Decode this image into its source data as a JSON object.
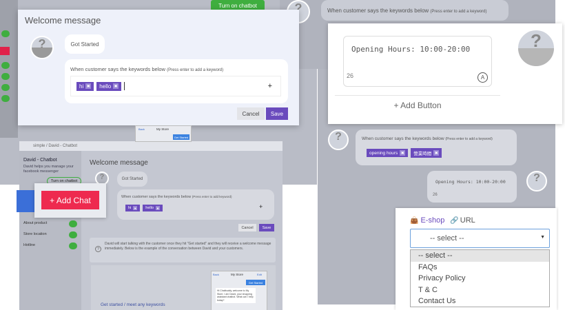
{
  "top": {
    "chatbot_button": "Turn on chatbot"
  },
  "modal": {
    "title": "Welcome message",
    "get_started": "Got Started",
    "keyword_label": "When customer says the keywords below",
    "keyword_hint": "(Press enter to add a keyword)",
    "keywords": [
      "hi",
      "hello"
    ],
    "add_icon": "+",
    "cancel": "Cancel",
    "save": "Save"
  },
  "right_top": {
    "keyword_label": "When customer says the keywords below",
    "keyword_hint": "(Press enter to add a keyword)"
  },
  "right_card": {
    "message": "Opening Hours: 10:00-20:00",
    "char_count": "26",
    "emoji_badge": "A",
    "add_button": "+ Add Button"
  },
  "right_mid": {
    "keyword_label": "When customer says the keywords below",
    "keyword_hint": "(Press enter to add a keyword)",
    "keywords": [
      "opening hours",
      "營業時間"
    ],
    "message": "Opening Hours: 10:00-20:00",
    "char_count": "26"
  },
  "lower": {
    "header": "simple  /  David - Chatbot",
    "sidebar_title": "David - Chatbot",
    "sidebar_desc": "David helps you manage your facebook messenger",
    "chatbot_toggle": "Turn on chatbot",
    "side_items": [
      "About product",
      "Store location",
      "Hotline"
    ],
    "title": "Welcome message",
    "get_started": "Got Started",
    "keyword_label": "When customer says the keywords below",
    "keyword_hint": "(Press enter to add keyword)",
    "keywords": [
      "hi",
      "hello"
    ],
    "cancel": "Cancel",
    "save": "Save",
    "info": "David will start talking with the customer once they hit \"Get started\" and they will receive a welcome message immediately. Below is the example of the conversation between David and your customers.",
    "get_started_link": "Get started / meet any keywords",
    "phone_title": "My Store",
    "phone_back": "Back",
    "phone_edit": "Edit",
    "phone_btn": "Get Started",
    "phone_msg": "Hi Chatbuddy, welcome to My Store. I am David, your shopping assistant chatbot. What can I help today?"
  },
  "add_chat": "+ Add Chat",
  "dropdown": {
    "eshop_label": "E-shop",
    "url_label": "URL",
    "selected": "-- select --",
    "options": [
      "-- select --",
      "FAQs",
      "Privacy Policy",
      "T & C",
      "Contact Us"
    ]
  },
  "colors": {
    "accent": "#6a4bbd",
    "green": "#3fae3f",
    "red": "#ee2a4f"
  }
}
